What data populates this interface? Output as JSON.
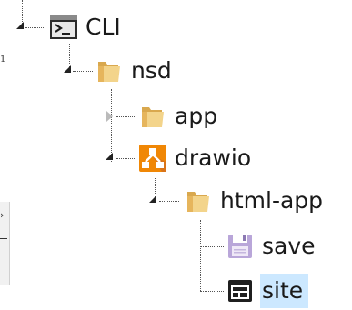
{
  "tree": {
    "items": [
      {
        "label": "CLI",
        "icon": "terminal-icon",
        "expanded": true
      },
      {
        "label": "nsd",
        "icon": "folder-icon",
        "expanded": true
      },
      {
        "label": "app",
        "icon": "folder-icon",
        "expanded": false
      },
      {
        "label": "drawio",
        "icon": "drawio-icon",
        "expanded": true
      },
      {
        "label": "html-app",
        "icon": "folder-icon",
        "expanded": true
      },
      {
        "label": "save",
        "icon": "floppy-icon"
      },
      {
        "label": "site",
        "icon": "site-window-icon",
        "selected": true
      }
    ]
  },
  "clipped": {
    "text": "1"
  },
  "colors": {
    "selection": "#cce8ff",
    "drawio_orange": "#f08705",
    "folder": "#e6c07a"
  }
}
